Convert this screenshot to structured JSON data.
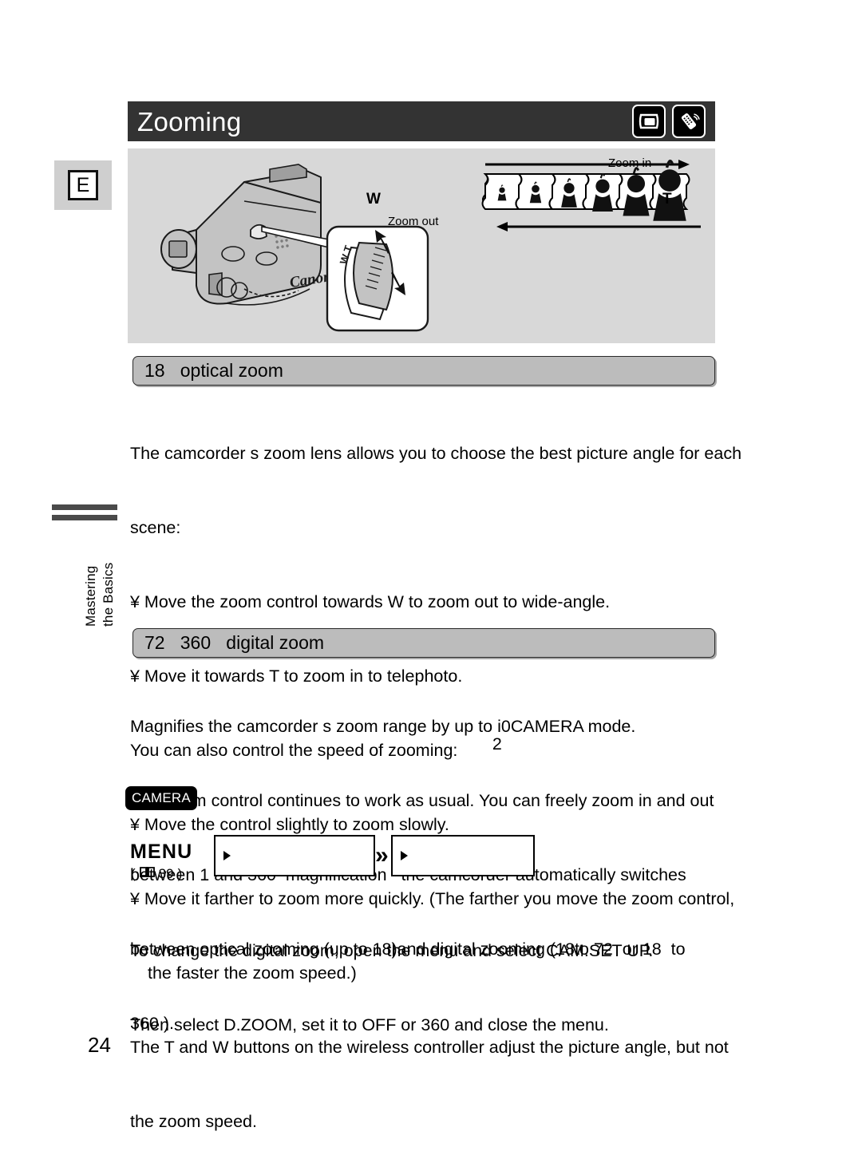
{
  "page": {
    "number": "24",
    "language_tab": "E"
  },
  "sidebar": {
    "chapter_line1": "Mastering",
    "chapter_line2": "the Basics"
  },
  "header": {
    "title": "Zooming",
    "icons": [
      {
        "name": "camcorder-tape-icon",
        "label": "CAMERA mode"
      },
      {
        "name": "wireless-controller-icon",
        "label": "Wireless controller"
      }
    ]
  },
  "illustration": {
    "zoom_in_label": "Zoom in",
    "zoom_out_label": "Zoom out",
    "wide_label": "W",
    "tele_label": "T",
    "lever_label": "W T",
    "brand": "Canon",
    "frame_count": 6
  },
  "sections": [
    {
      "heading": "18   optical zoom",
      "body": [
        "The camcorder s zoom lens allows you to choose the best picture angle for each",
        "scene:",
        "¥ Move the zoom control towards W to zoom out to wide-angle.",
        "¥ Move it towards T to zoom in to telephoto.",
        "You can also control the speed of zooming:",
        "¥ Move the control slightly to zoom slowly.",
        "¥ Move it farther to zoom more quickly. (The farther you move the zoom control,",
        "the faster the zoom speed.)",
        "The T and W buttons on the wireless controller adjust the picture angle, but not",
        "the zoom speed."
      ]
    },
    {
      "heading": "72   360   digital zoom",
      "body_line1_a": "Magnifies the camcorder s zoom range by up to i",
      "body_line1_overlap": "2",
      "body_line1_b": "0CAMERA mode.",
      "body": [
        "The zoom control continues to work as usual. You can freely zoom in and out",
        "between 1 and 360  magnification   the camcorder automatically switches",
        "between optical zooming (up to 18",
        ")and digital zooming (18to 72  or 18  to",
        "360 )."
      ]
    }
  ],
  "menu_block": {
    "mode_badge": "CAMERA",
    "menu_label": "MENU",
    "page_ref_open": "(",
    "page_ref_icon": "book-icon",
    "page_ref_number": "39",
    "page_ref_close": ")",
    "box1_label": "",
    "box2_label": "",
    "separator": "»"
  },
  "footer_instructions": [
    "To change the digital zoom, open the menu and select CAM.SET UP.",
    "Then select D.ZOOM, set it to OFF or 360 and close the menu."
  ],
  "colors": {
    "titlebar_bg": "#333333",
    "panel_bg": "#d8d8d8",
    "pill_bg": "#bcbcbc",
    "badge_bg": "#000000"
  }
}
